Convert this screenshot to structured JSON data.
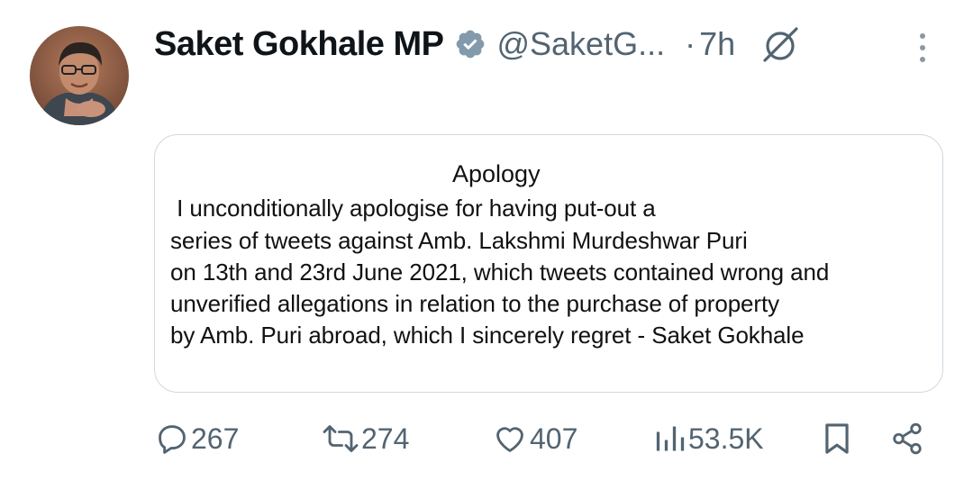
{
  "author": {
    "name": "Saket Gokhale MP",
    "handle": "@SaketG...",
    "separator": "·",
    "time": "7h",
    "verified_icon": "verified-badge-icon",
    "verified_color": "#829aab"
  },
  "card": {
    "title": "Apology",
    "lines": [
      " I unconditionally apologise for having put-out a",
      "series of tweets against Amb. Lakshmi Murdeshwar Puri",
      "on 13th and 23rd June 2021, which tweets contained wrong and",
      "unverified allegations in relation to the purchase of property",
      "by Amb. Puri abroad, which I sincerely regret - Saket Gokhale"
    ]
  },
  "actions": {
    "replies": "267",
    "retweets": "274",
    "likes": "407",
    "views": "53.5K"
  },
  "colors": {
    "text": "#0f1419",
    "muted": "#536471",
    "border": "#cfd9de"
  }
}
